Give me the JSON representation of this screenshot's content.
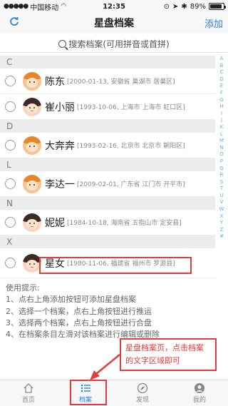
{
  "status": {
    "carrier": "中国移动",
    "wifi": "wifi-icon",
    "time": "12:35",
    "battery": "89%",
    "battery_level": 0.89
  },
  "nav": {
    "title": "星盘档案",
    "add_label": "添加",
    "refresh_icon": "refresh-icon"
  },
  "search": {
    "placeholder": "搜索档案(可用拼音或首拼)"
  },
  "sections": [
    {
      "letter": "C",
      "people": [
        {
          "name": "陈东",
          "info": "[2000-01-13, 安徽省 巢湖市 居巢区]",
          "gender": "male"
        },
        {
          "name": "崔小丽",
          "info": "[1993-10-06, 上海市 上海市 虹口区]",
          "gender": "female"
        }
      ]
    },
    {
      "letter": "D",
      "people": [
        {
          "name": "大奔奔",
          "info": "[1993-02-16, 北京市 北京市 朝阳区]",
          "gender": "male"
        }
      ]
    },
    {
      "letter": "L",
      "people": [
        {
          "name": "李达一",
          "info": "[2009-02-01, 广东省 江门市 开平市]",
          "gender": "male"
        }
      ]
    },
    {
      "letter": "N",
      "people": [
        {
          "name": "妮妮",
          "info": "[1984-10-18, 海南省 五指山市 定安县]",
          "gender": "female"
        }
      ]
    },
    {
      "letter": "X",
      "people": [
        {
          "name": "星女",
          "info": "[1980-11-06, 福建省 福州市 罗源县]",
          "gender": "female"
        }
      ]
    }
  ],
  "index_letters": [
    "A",
    "B",
    "C",
    "D",
    "E",
    "F",
    "G",
    "H",
    "I",
    "J",
    "K",
    "L",
    "M",
    "N",
    "O",
    "P",
    "Q",
    "R",
    "S",
    "T",
    "U",
    "V",
    "W",
    "X",
    "Y",
    "Z",
    "#"
  ],
  "tips": {
    "title": "使用提示:",
    "lines": [
      "1、点右上角添加按钮可添加星盘档案",
      "2、选择一个档案，点右上角按钮进行推运",
      "3、选择两个档案，点右上角按钮进行合盘",
      "4、在档案条目左滑对该档案进行编辑或删除"
    ]
  },
  "callout": {
    "line1": "星盘档案页，点击档案",
    "line2": "的文字区域即可"
  },
  "tabs": [
    {
      "label": "首页",
      "icon": "home-icon",
      "active": false
    },
    {
      "label": "档案",
      "icon": "list-icon",
      "active": true
    },
    {
      "label": "发现",
      "icon": "compass-icon",
      "active": false
    },
    {
      "label": "我的",
      "icon": "user-icon",
      "active": false
    }
  ],
  "colors": {
    "accent": "#2f7fd6",
    "annotation": "#e23c3c"
  }
}
